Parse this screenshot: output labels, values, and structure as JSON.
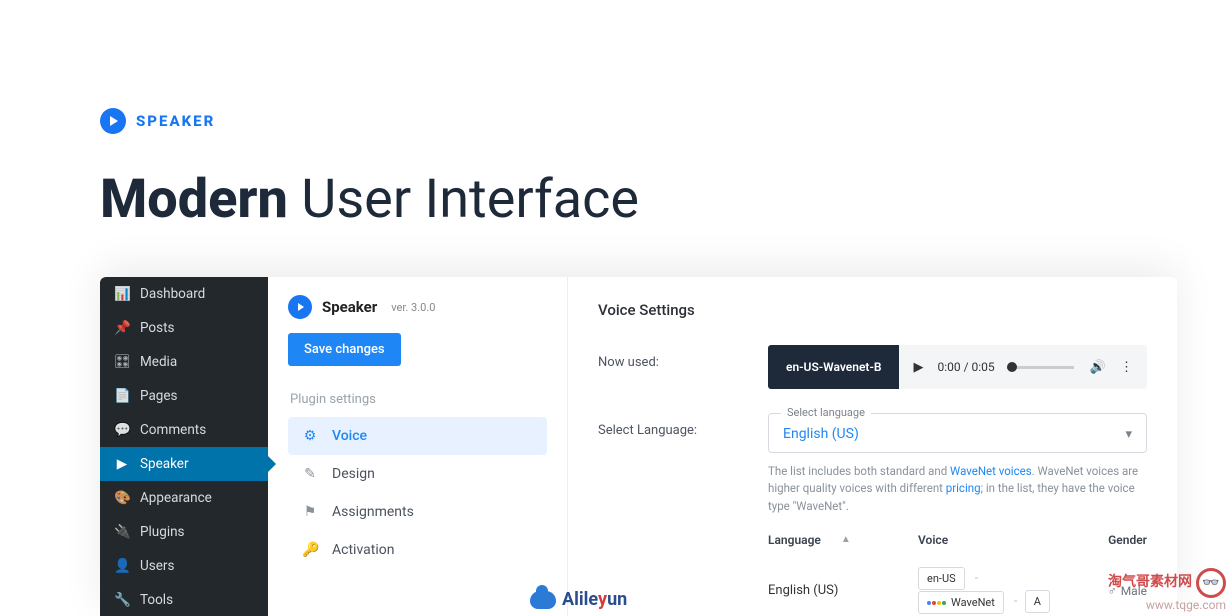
{
  "brand": {
    "name": "SPEAKER"
  },
  "heading": {
    "bold": "Modern",
    "rest": " User Interface"
  },
  "wp_sidebar": [
    {
      "icon": "📊",
      "label": "Dashboard"
    },
    {
      "icon": "📌",
      "label": "Posts"
    },
    {
      "icon": "🎛",
      "label": "Media"
    },
    {
      "icon": "📄",
      "label": "Pages"
    },
    {
      "icon": "💬",
      "label": "Comments"
    },
    {
      "icon": "▶",
      "label": "Speaker"
    },
    {
      "icon": "🎨",
      "label": "Appearance"
    },
    {
      "icon": "🔌",
      "label": "Plugins"
    },
    {
      "icon": "👤",
      "label": "Users"
    },
    {
      "icon": "🔧",
      "label": "Tools"
    }
  ],
  "plugin": {
    "title": "Speaker",
    "version": "ver. 3.0.0",
    "save": "Save changes",
    "section": "Plugin settings",
    "nav": [
      {
        "icon": "⚙",
        "label": "Voice"
      },
      {
        "icon": "✎",
        "label": "Design"
      },
      {
        "icon": "⚑",
        "label": "Assignments"
      },
      {
        "icon": "🔑",
        "label": "Activation"
      }
    ]
  },
  "main": {
    "title": "Voice Settings",
    "now_used_label": "Now used:",
    "player_badge": "en-US-Wavenet-B",
    "time": "0:00 / 0:05",
    "select_lang_label": "Select Language:",
    "select_legend": "Select language",
    "select_value": "English (US)",
    "help1": "The list includes both standard and ",
    "help_link1": "WaveNet voices",
    "help2": ". WaveNet voices are higher quality voices with different ",
    "help_link2": "pricing",
    "help3": "; in the list, they have the voice type \"WaveNet\".",
    "cols": {
      "lang": "Language",
      "voice": "Voice",
      "gender": "Gender"
    },
    "row0": {
      "lang": "English (US)",
      "chip1": "en-US",
      "chip2": "WaveNet",
      "chip3": "A",
      "gender": "Male"
    }
  },
  "wm1": {
    "a": "Alile",
    "b": "y",
    "c": "un"
  },
  "wm2": {
    "cn": "淘气哥素材网",
    "url": "www.tqge.com"
  }
}
